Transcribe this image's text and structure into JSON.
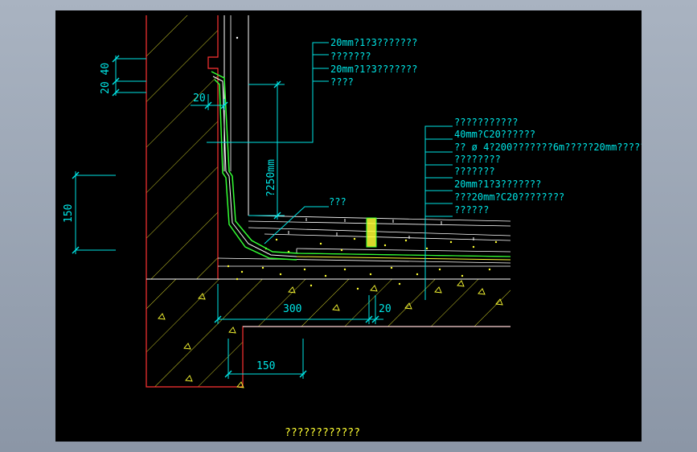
{
  "colors": {
    "background": "#000000",
    "frame": "#a9b3c1",
    "cyan": "#00e5e5",
    "yellow": "#ffff33",
    "white": "#ffffff",
    "red": "#ff3333",
    "green": "#33ff33"
  },
  "callouts_wall": [
    "20mm?1?3???????",
    "???????",
    "20mm?1?3???????",
    "????"
  ],
  "callouts_floor": [
    "???????????",
    "40mm?C20??????",
    "?? ø 4?200???????6m?????20mm?????",
    "????????",
    "???????",
    "20mm?1?3???????",
    "???20mm?C20????????",
    "??????"
  ],
  "callout_joint": "???",
  "dimensions": {
    "top_stack": "20 40",
    "offset_20": "20",
    "height_250": "?250mm",
    "left_150": "150",
    "base_300": "300",
    "base_20": "20",
    "bottom_150": "150"
  },
  "caption": "????????????"
}
